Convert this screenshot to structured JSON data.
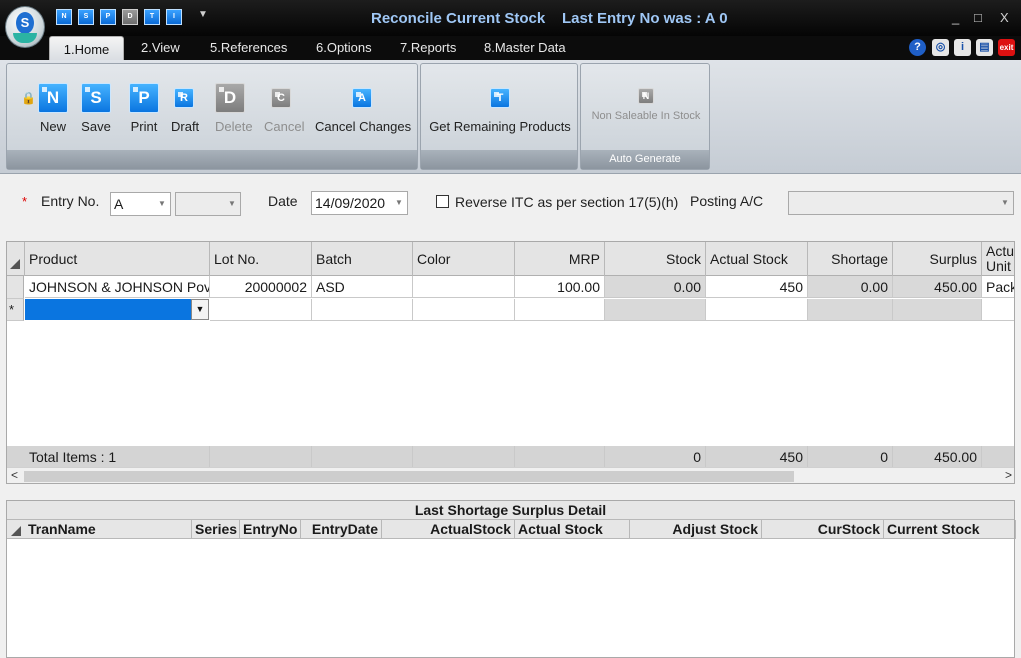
{
  "app": {
    "title": "Reconcile Current Stock",
    "last_entry": "Last Entry No was : A 0",
    "logo_letter": "S"
  },
  "quick_access": [
    "N",
    "S",
    "P",
    "D",
    "T",
    "I"
  ],
  "window_controls": {
    "minimize": "_",
    "maximize": "□",
    "close": "X"
  },
  "tabs": [
    "1.Home",
    "2.View",
    "5.References",
    "6.Options",
    "7.Reports",
    "8.Master Data"
  ],
  "help_icons": [
    "?",
    "◎",
    "i",
    "▤",
    "exit"
  ],
  "ribbon": {
    "buttons": [
      {
        "label": "New",
        "glyph": "N",
        "enabled": true
      },
      {
        "label": "Save",
        "glyph": "S",
        "enabled": true
      },
      {
        "label": "Print",
        "glyph": "P",
        "enabled": true
      },
      {
        "label": "Draft",
        "glyph": "R",
        "enabled": true
      },
      {
        "label": "Delete",
        "glyph": "D",
        "enabled": false
      },
      {
        "label": "Cancel",
        "glyph": "C",
        "enabled": false
      },
      {
        "label": "Cancel Changes",
        "glyph": "A",
        "enabled": true
      }
    ],
    "get_remaining": {
      "label": "Get Remaining Products",
      "glyph": "T"
    },
    "non_saleable": {
      "label": "Non Saleable In Stock",
      "glyph": "N"
    },
    "auto_generate_label": "Auto Generate"
  },
  "form": {
    "required_mark": "*",
    "entry_no_label": "Entry No.",
    "entry_series": "A",
    "entry_number": "",
    "date_label": "Date",
    "date_value": "14/09/2020",
    "reverse_itc_label": "Reverse ITC as per section 17(5)(h)",
    "reverse_itc_checked": false,
    "posting_ac_label": "Posting A/C",
    "posting_ac_value": ""
  },
  "grid": {
    "columns": [
      "Product",
      "Lot No.",
      "Batch",
      "Color",
      "MRP",
      "Stock",
      "Actual Stock",
      "Shortage",
      "Surplus",
      "Actual Unit"
    ],
    "rows": [
      {
        "product": "JOHNSON & JOHNSON Pov",
        "lot_no": "20000002",
        "batch": "ASD",
        "color": "",
        "mrp": "100.00",
        "stock": "0.00",
        "actual_stock": "450",
        "shortage": "0.00",
        "surplus": "450.00",
        "unit": "Pack"
      }
    ],
    "new_row_marker": "*",
    "totals": {
      "label": "Total Items : 1",
      "stock": "0",
      "actual_stock": "450",
      "shortage": "0",
      "surplus": "450.00"
    },
    "scroll_left": "<",
    "scroll_right": ">"
  },
  "detail": {
    "title": "Last Shortage Surplus Detail",
    "columns": [
      "TranName",
      "Series",
      "EntryNo",
      "EntryDate",
      "ActualStock",
      "Actual Stock",
      "Adjust Stock",
      "CurStock",
      "Current Stock"
    ]
  }
}
